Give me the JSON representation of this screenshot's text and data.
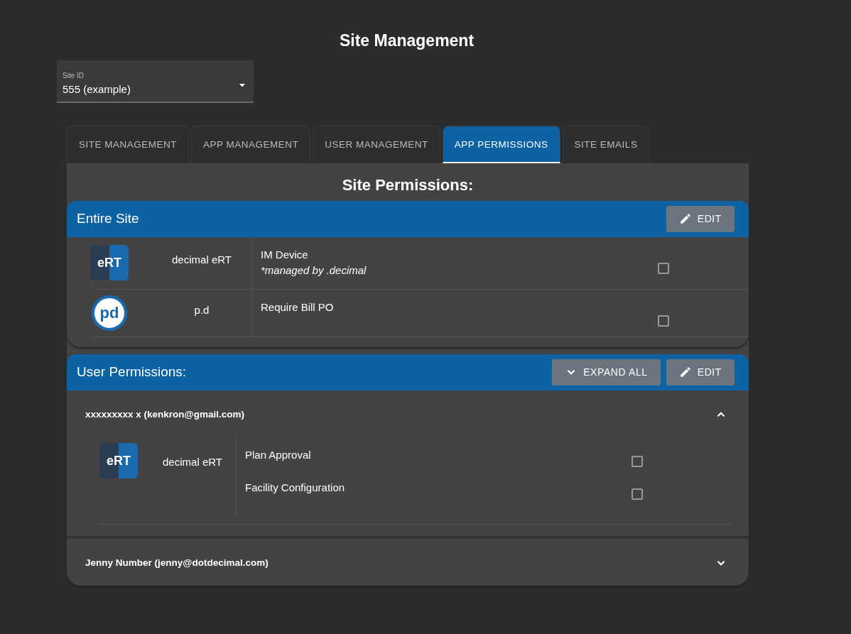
{
  "title": "Site Management",
  "site_select": {
    "label": "Site ID",
    "value": "555 (example)"
  },
  "tabs": [
    {
      "label": "SITE MANAGEMENT",
      "selected": false
    },
    {
      "label": "APP MANAGEMENT",
      "selected": false
    },
    {
      "label": "USER MANAGEMENT",
      "selected": false
    },
    {
      "label": "APP PERMISSIONS",
      "selected": true
    },
    {
      "label": "SITE EMAILS",
      "selected": false
    }
  ],
  "heading": "Site Permissions:",
  "entire_site": {
    "title": "Entire Site",
    "edit_button": "EDIT",
    "rows": [
      {
        "kind": "ert",
        "logo_text": "eRT",
        "app": "decimal eRT",
        "permission": "IM Device",
        "note": "*managed by .decimal",
        "checked": false
      },
      {
        "kind": "pd",
        "logo_text": "pd",
        "app": "p.d",
        "permission": "Require Bill PO",
        "checked": false
      }
    ]
  },
  "user_permissions": {
    "title": "User Permissions:",
    "expand_button": "EXPAND ALL",
    "edit_button": "EDIT",
    "users": [
      {
        "name": "xxxxxxxxx x (kenkron@gmail.com)",
        "expanded": true,
        "apps": [
          {
            "kind": "ert",
            "logo_text": "eRT",
            "app": "decimal eRT",
            "permissions": [
              {
                "label": "Plan Approval",
                "checked": false
              },
              {
                "label": "Facility Configuration",
                "checked": false
              }
            ]
          }
        ]
      },
      {
        "name": "Jenny Number (jenny@dotdecimal.com)",
        "expanded": false
      }
    ]
  }
}
